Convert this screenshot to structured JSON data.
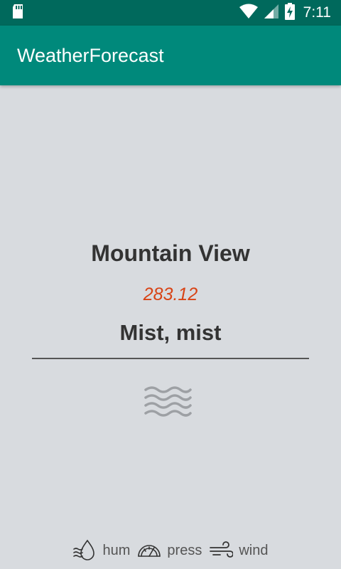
{
  "status_bar": {
    "time": "7:11",
    "icons": [
      "sd-card-icon",
      "wifi-icon",
      "signal-icon",
      "battery-charging-icon"
    ]
  },
  "app_bar": {
    "title": "WeatherForecast"
  },
  "weather": {
    "city": "Mountain View",
    "temperature": "283.12",
    "description": "Mist, mist",
    "icon": "mist-icon"
  },
  "stats": {
    "humidity_label": "hum",
    "pressure_label": "press",
    "wind_label": "wind"
  },
  "colors": {
    "status_bar": "#00695c",
    "app_bar": "#00897b",
    "background": "#d8dbdf",
    "temperature": "#d84315",
    "text": "#333333"
  }
}
